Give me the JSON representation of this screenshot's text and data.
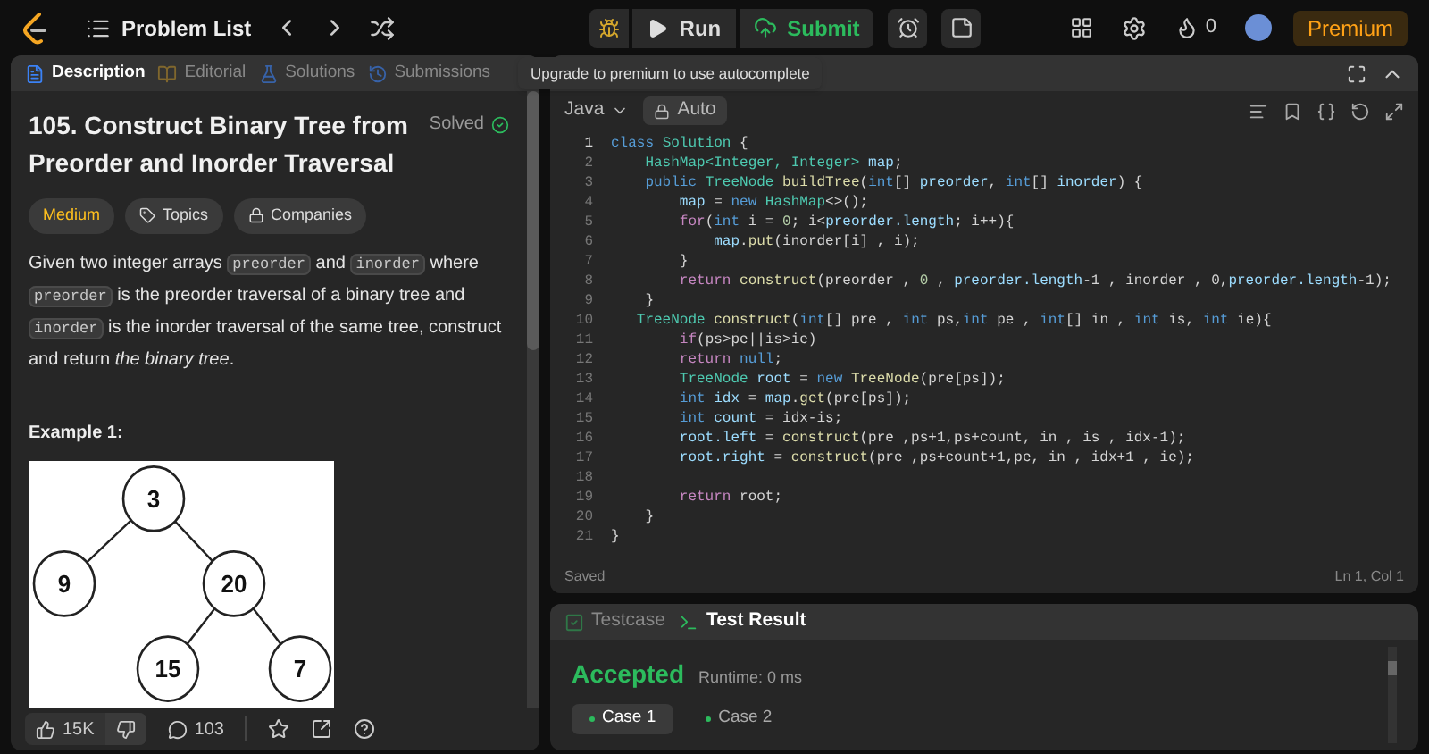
{
  "topbar": {
    "problem_list": "Problem List",
    "run": "Run",
    "submit": "Submit",
    "streak": "0",
    "premium": "Premium"
  },
  "tooltip": "Upgrade to premium to use autocomplete",
  "left_tabs": [
    {
      "label": "Description",
      "selected": true
    },
    {
      "label": "Editorial",
      "selected": false
    },
    {
      "label": "Solutions",
      "selected": false
    },
    {
      "label": "Submissions",
      "selected": false
    }
  ],
  "problem": {
    "title": "105. Construct Binary Tree from Preorder and Inorder Traversal",
    "status": "Solved",
    "difficulty": "Medium",
    "tags": [
      "Topics",
      "Companies"
    ],
    "description": [
      {
        "kind": "text",
        "text": "Given two integer arrays "
      },
      {
        "kind": "code",
        "text": "preorder"
      },
      {
        "kind": "text",
        "text": " and "
      },
      {
        "kind": "code",
        "text": "inorder"
      },
      {
        "kind": "text",
        "text": " where "
      },
      {
        "kind": "code",
        "text": "preorder"
      },
      {
        "kind": "text",
        "text": " is the preorder traversal of a binary tree and "
      },
      {
        "kind": "code",
        "text": "inorder"
      },
      {
        "kind": "text",
        "text": " is the inorder traversal of the same tree, construct and return "
      },
      {
        "kind": "italic",
        "text": "the binary tree"
      },
      {
        "kind": "text",
        "text": "."
      }
    ],
    "example_title": "Example 1:",
    "example_tree": [
      "3",
      "9",
      "20",
      "15",
      "7"
    ]
  },
  "left_footer": {
    "likes": "15K",
    "comments": "103"
  },
  "editor": {
    "language": "Java",
    "mode": "Auto",
    "status": "Saved",
    "cursor": "Ln 1, Col 1",
    "lines": [
      {
        "number": "1",
        "tokens": [
          {
            "kind": "keyword",
            "text": "class"
          },
          {
            "kind": "type",
            "text": " Solution"
          },
          {
            "kind": "plain",
            "text": " {"
          }
        ]
      },
      {
        "number": "2",
        "tokens": [
          {
            "kind": "type",
            "text": "    HashMap<Integer, Integer>"
          },
          {
            "kind": "variable",
            "text": " map"
          },
          {
            "kind": "plain",
            "text": ";"
          }
        ]
      },
      {
        "number": "3",
        "tokens": [
          {
            "kind": "keyword",
            "text": "    public"
          },
          {
            "kind": "type",
            "text": " TreeNode"
          },
          {
            "kind": "function",
            "text": " buildTree"
          },
          {
            "kind": "plain",
            "text": "("
          },
          {
            "kind": "keyword",
            "text": "int"
          },
          {
            "kind": "plain",
            "text": "[] "
          },
          {
            "kind": "variable",
            "text": "preorder"
          },
          {
            "kind": "plain",
            "text": ", "
          },
          {
            "kind": "keyword",
            "text": "int"
          },
          {
            "kind": "plain",
            "text": "[] "
          },
          {
            "kind": "variable",
            "text": "inorder"
          },
          {
            "kind": "plain",
            "text": ") {"
          }
        ]
      },
      {
        "number": "4",
        "tokens": [
          {
            "kind": "variable",
            "text": "        map"
          },
          {
            "kind": "plain",
            "text": " = "
          },
          {
            "kind": "keyword",
            "text": "new"
          },
          {
            "kind": "type",
            "text": " HashMap"
          },
          {
            "kind": "plain",
            "text": "<>();"
          }
        ]
      },
      {
        "number": "5",
        "tokens": [
          {
            "kind": "control",
            "text": "        for"
          },
          {
            "kind": "plain",
            "text": "("
          },
          {
            "kind": "keyword",
            "text": "int"
          },
          {
            "kind": "plain",
            "text": " i = "
          },
          {
            "kind": "number",
            "text": "0"
          },
          {
            "kind": "plain",
            "text": "; i<"
          },
          {
            "kind": "variable",
            "text": "preorder.length"
          },
          {
            "kind": "plain",
            "text": "; i++){"
          }
        ]
      },
      {
        "number": "6",
        "tokens": [
          {
            "kind": "variable",
            "text": "            map"
          },
          {
            "kind": "plain",
            "text": "."
          },
          {
            "kind": "function",
            "text": "put"
          },
          {
            "kind": "plain",
            "text": "(inorder[i] , i);"
          }
        ]
      },
      {
        "number": "7",
        "tokens": [
          {
            "kind": "plain",
            "text": "        }"
          }
        ]
      },
      {
        "number": "8",
        "tokens": [
          {
            "kind": "control",
            "text": "        return"
          },
          {
            "kind": "function",
            "text": " construct"
          },
          {
            "kind": "plain",
            "text": "(preorder , "
          },
          {
            "kind": "number",
            "text": "0"
          },
          {
            "kind": "plain",
            "text": " , "
          },
          {
            "kind": "variable",
            "text": "preorder.length"
          },
          {
            "kind": "plain",
            "text": "-1 , inorder , 0,"
          },
          {
            "kind": "variable",
            "text": "preorder.length"
          },
          {
            "kind": "plain",
            "text": "-1);"
          }
        ]
      },
      {
        "number": "9",
        "tokens": [
          {
            "kind": "plain",
            "text": "    }"
          }
        ]
      },
      {
        "number": "10",
        "tokens": [
          {
            "kind": "type",
            "text": "   TreeNode"
          },
          {
            "kind": "function",
            "text": " construct"
          },
          {
            "kind": "plain",
            "text": "("
          },
          {
            "kind": "keyword",
            "text": "int"
          },
          {
            "kind": "plain",
            "text": "[] pre , "
          },
          {
            "kind": "keyword",
            "text": "int"
          },
          {
            "kind": "plain",
            "text": " ps,"
          },
          {
            "kind": "keyword",
            "text": "int"
          },
          {
            "kind": "plain",
            "text": " pe , "
          },
          {
            "kind": "keyword",
            "text": "int"
          },
          {
            "kind": "plain",
            "text": "[] in , "
          },
          {
            "kind": "keyword",
            "text": "int"
          },
          {
            "kind": "plain",
            "text": " is, "
          },
          {
            "kind": "keyword",
            "text": "int"
          },
          {
            "kind": "plain",
            "text": " ie){"
          }
        ]
      },
      {
        "number": "11",
        "tokens": [
          {
            "kind": "control",
            "text": "        if"
          },
          {
            "kind": "plain",
            "text": "(ps>pe||is>ie)"
          }
        ]
      },
      {
        "number": "12",
        "tokens": [
          {
            "kind": "control",
            "text": "        return"
          },
          {
            "kind": "keyword",
            "text": " null"
          },
          {
            "kind": "plain",
            "text": ";"
          }
        ]
      },
      {
        "number": "13",
        "tokens": [
          {
            "kind": "type",
            "text": "        TreeNode"
          },
          {
            "kind": "variable",
            "text": " root"
          },
          {
            "kind": "plain",
            "text": " = "
          },
          {
            "kind": "keyword",
            "text": "new"
          },
          {
            "kind": "function",
            "text": " TreeNode"
          },
          {
            "kind": "plain",
            "text": "(pre[ps]);"
          }
        ]
      },
      {
        "number": "14",
        "tokens": [
          {
            "kind": "keyword",
            "text": "        int"
          },
          {
            "kind": "variable",
            "text": " idx"
          },
          {
            "kind": "plain",
            "text": " = "
          },
          {
            "kind": "variable",
            "text": "map"
          },
          {
            "kind": "plain",
            "text": "."
          },
          {
            "kind": "function",
            "text": "get"
          },
          {
            "kind": "plain",
            "text": "(pre[ps]);"
          }
        ]
      },
      {
        "number": "15",
        "tokens": [
          {
            "kind": "keyword",
            "text": "        int"
          },
          {
            "kind": "variable",
            "text": " count"
          },
          {
            "kind": "plain",
            "text": " = idx-is;"
          }
        ]
      },
      {
        "number": "16",
        "tokens": [
          {
            "kind": "variable",
            "text": "        root.left"
          },
          {
            "kind": "plain",
            "text": " = "
          },
          {
            "kind": "function",
            "text": "construct"
          },
          {
            "kind": "plain",
            "text": "(pre ,ps+1,ps+count, in , is , idx-1);"
          }
        ]
      },
      {
        "number": "17",
        "tokens": [
          {
            "kind": "variable",
            "text": "        root.right"
          },
          {
            "kind": "plain",
            "text": " = "
          },
          {
            "kind": "function",
            "text": "construct"
          },
          {
            "kind": "plain",
            "text": "(pre ,ps+count+1,pe, in , idx+1 , ie);"
          }
        ]
      },
      {
        "number": "18"
      },
      {
        "number": "19",
        "tokens": [
          {
            "kind": "control",
            "text": "        return"
          },
          {
            "kind": "plain",
            "text": " root;"
          }
        ]
      },
      {
        "number": "20",
        "tokens": [
          {
            "kind": "plain",
            "text": "    }"
          }
        ]
      },
      {
        "number": "21",
        "tokens": [
          {
            "kind": "plain",
            "text": "}"
          }
        ]
      }
    ]
  },
  "result_tabs": [
    {
      "label": "Testcase",
      "selected": false
    },
    {
      "label": "Test Result",
      "selected": true
    }
  ],
  "result": {
    "verdict": "Accepted",
    "runtime": "Runtime: 0 ms",
    "cases": [
      {
        "label": "Case 1",
        "selected": true
      },
      {
        "label": "Case 2",
        "selected": false
      }
    ]
  }
}
